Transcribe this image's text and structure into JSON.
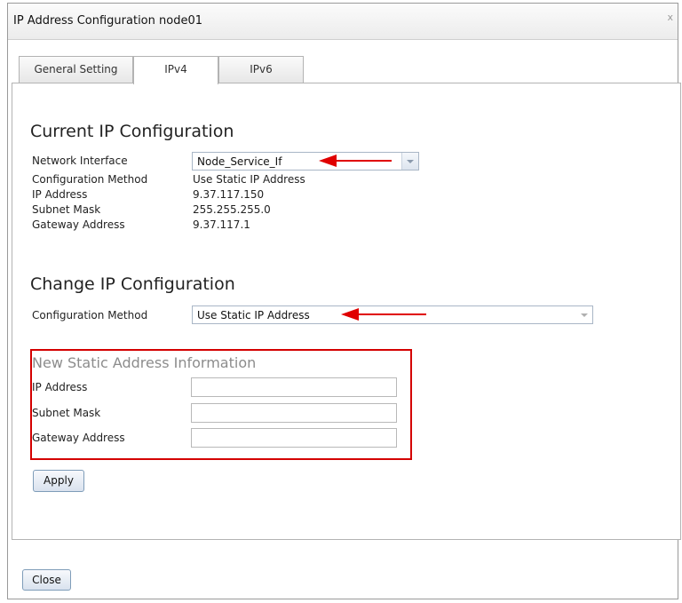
{
  "window": {
    "title": "IP Address Configuration node01",
    "close_glyph": "x"
  },
  "tabs": [
    {
      "label": "General Setting",
      "active": false
    },
    {
      "label": "IPv4",
      "active": true
    },
    {
      "label": "IPv6",
      "active": false
    }
  ],
  "current": {
    "heading": "Current IP Configuration",
    "network_interface_label": "Network Interface",
    "network_interface_value": "Node_Service_If",
    "method_label": "Configuration Method",
    "method_value": "Use Static IP Address",
    "ip_label": "IP Address",
    "ip_value": "9.37.117.150",
    "subnet_label": "Subnet Mask",
    "subnet_value": "255.255.255.0",
    "gateway_label": "Gateway Address",
    "gateway_value": "9.37.117.1"
  },
  "change": {
    "heading": "Change IP Configuration",
    "method_label": "Configuration Method",
    "method_value": "Use Static IP Address"
  },
  "new_static": {
    "heading": "New Static Address Information",
    "ip_label": "IP Address",
    "ip_value": "",
    "subnet_label": "Subnet Mask",
    "subnet_value": "",
    "gateway_label": "Gateway Address",
    "gateway_value": ""
  },
  "buttons": {
    "apply": "Apply",
    "close": "Close"
  },
  "colors": {
    "annotation_red": "#e00000",
    "highlight_box": "#d40000"
  },
  "icons": {
    "dropdown": "chevron-down-icon",
    "annotation": "red-arrow-icon"
  }
}
